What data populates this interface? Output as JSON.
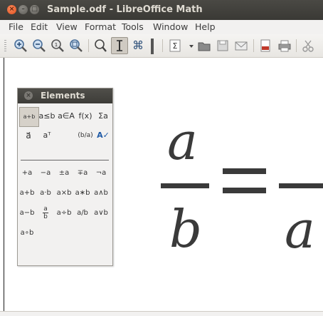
{
  "window": {
    "title": "Sample.odf - LibreOffice Math"
  },
  "window_controls": {
    "close": "×",
    "minimize": "–",
    "maximize": "□"
  },
  "menu": [
    "File",
    "Edit",
    "View",
    "Format",
    "Tools",
    "Window",
    "Help"
  ],
  "toolbar": {
    "icons": [
      "zoom-in-icon",
      "zoom-out-icon",
      "zoom-100-icon",
      "show-all-icon",
      "update-icon",
      "cursor-icon",
      "formula-cursor-icon",
      "symbols-icon",
      "open-icon",
      "save-icon",
      "email-icon",
      "export-pdf-icon",
      "print-icon",
      "cut-icon"
    ]
  },
  "elements_panel": {
    "title": "Elements",
    "close": "×",
    "categories": [
      "a+b",
      "a≤b",
      "a∈A",
      "f(x)",
      "Σa",
      "a⃗",
      "aᵀ",
      "(b/a)",
      "A✓"
    ],
    "operators": {
      "row1": [
        "+a",
        "−a",
        "±a",
        "∓a",
        "¬a"
      ],
      "row2": [
        "a+b",
        "a·b",
        "a×b",
        "a∗b",
        "a∧b"
      ],
      "row3": [
        "a−b",
        "a/b",
        "a÷b",
        "a/b",
        "a∨b"
      ],
      "row4": [
        "a∘b"
      ]
    }
  },
  "formula": {
    "lhs_numerator": "a",
    "lhs_denominator": "b",
    "rhs_denominator": "a"
  }
}
